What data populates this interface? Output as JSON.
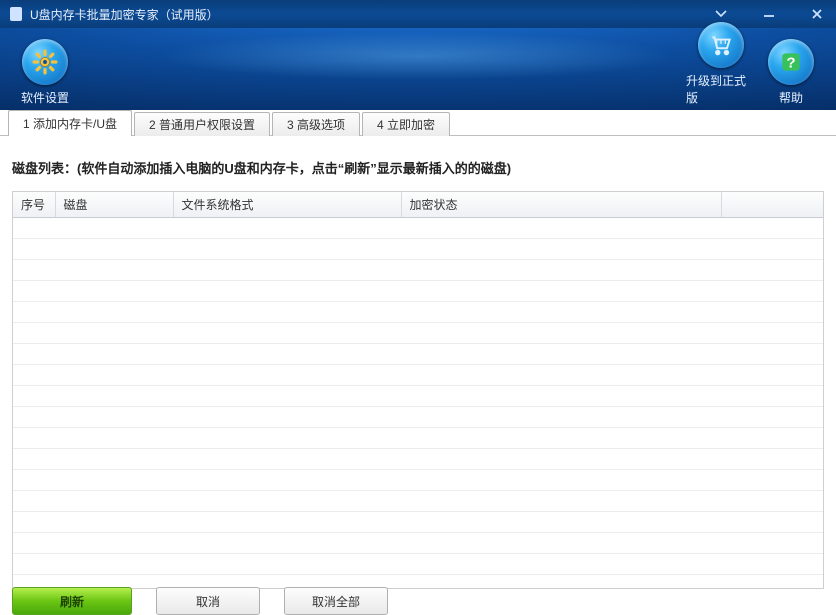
{
  "window": {
    "title": "U盘内存卡批量加密专家（试用版）"
  },
  "toolbar": {
    "settings_label": "软件设置",
    "upgrade_label": "升级到正式版",
    "help_label": "帮助"
  },
  "tabs": [
    {
      "label": "1 添加内存卡/U盘"
    },
    {
      "label": "2 普通用户权限设置"
    },
    {
      "label": "3 高级选项"
    },
    {
      "label": "4 立即加密"
    }
  ],
  "hint_text": "磁盘列表：(软件自动添加插入电脑的U盘和内存卡，点击“刷新”显示最新插入的的磁盘)",
  "columns": {
    "c0": "序号",
    "c1": "磁盘",
    "c2": "文件系统格式",
    "c3": "加密状态",
    "c4": ""
  },
  "rows": [],
  "buttons": {
    "refresh": "刷新",
    "cancel": "取消",
    "cancel_all": "取消全部"
  },
  "colors": {
    "accent_blue": "#0d4ea1",
    "accent_green": "#6bc513"
  }
}
